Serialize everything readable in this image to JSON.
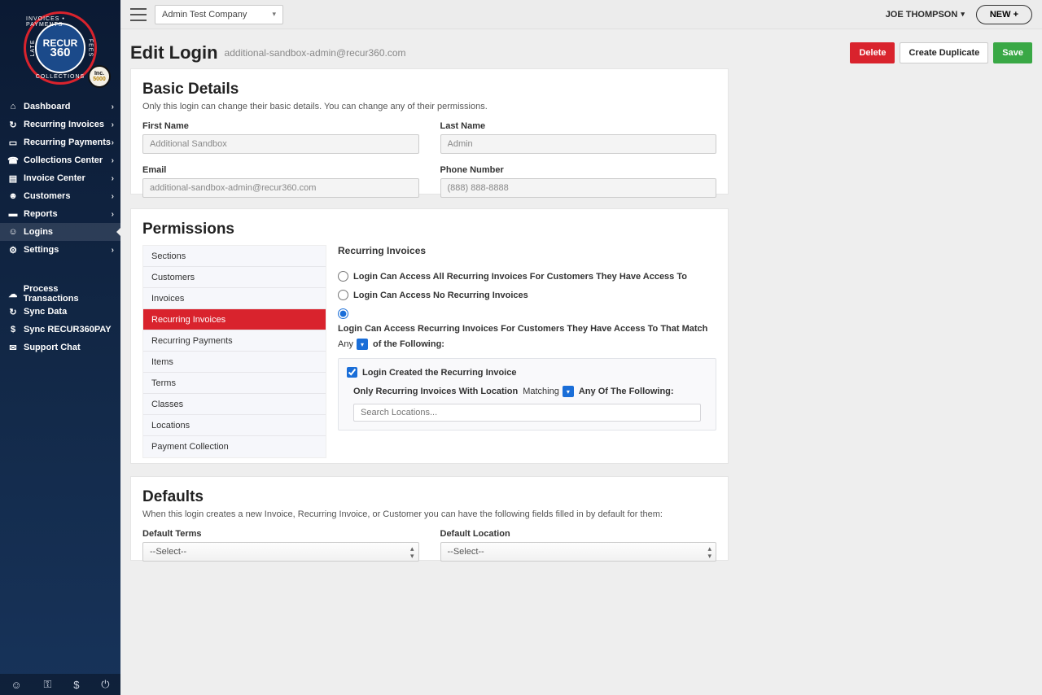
{
  "brand": {
    "name": "RECUR",
    "num": "360",
    "ring_top": "INVOICES • PAYMENTS",
    "ring_bottom": "COLLECTIONS",
    "ring_left": "LATE",
    "ring_right": "FEES",
    "inc1": "Inc.",
    "inc2": "5000"
  },
  "topbar": {
    "company": "Admin Test Company",
    "user": "JOE THOMPSON",
    "new": "NEW +"
  },
  "page": {
    "title": "Edit Login",
    "email": "additional-sandbox-admin@recur360.com",
    "actions": {
      "delete": "Delete",
      "dup": "Create Duplicate",
      "save": "Save"
    }
  },
  "nav": {
    "items": [
      {
        "icon": "⌂",
        "label": "Dashboard",
        "arrow": true
      },
      {
        "icon": "↻",
        "label": "Recurring Invoices",
        "arrow": true
      },
      {
        "icon": "☰",
        "label": "Recurring Payments",
        "arrow": true
      },
      {
        "icon": "☎",
        "label": "Collections Center",
        "arrow": true
      },
      {
        "icon": "▤",
        "label": "Invoice Center",
        "arrow": true
      },
      {
        "icon": "☻",
        "label": "Customers",
        "arrow": true
      },
      {
        "icon": "▬",
        "label": "Reports",
        "arrow": true
      },
      {
        "icon": "☺",
        "label": "Logins",
        "arrow": false,
        "active": true
      },
      {
        "icon": "⚙",
        "label": "Settings",
        "arrow": true
      }
    ],
    "utility": [
      {
        "icon": "☁",
        "label": "Process Transactions"
      },
      {
        "icon": "↻",
        "label": "Sync Data"
      },
      {
        "icon": "$",
        "label": "Sync RECUR360PAY"
      },
      {
        "icon": "✉",
        "label": "Support Chat"
      }
    ]
  },
  "basic": {
    "heading": "Basic Details",
    "desc": "Only this login can change their basic details. You can change any of their permissions.",
    "first_label": "First Name",
    "first_val": "Additional Sandbox",
    "last_label": "Last Name",
    "last_val": "Admin",
    "email_label": "Email",
    "email_val": "additional-sandbox-admin@recur360.com",
    "phone_label": "Phone Number",
    "phone_val": "(888) 888-8888"
  },
  "perm": {
    "heading": "Permissions",
    "tabs": [
      "Sections",
      "Customers",
      "Invoices",
      "Recurring Invoices",
      "Recurring Payments",
      "Items",
      "Terms",
      "Classes",
      "Locations",
      "Payment Collection"
    ],
    "active_tab": 3,
    "content_title": "Recurring Invoices",
    "r1": "Login Can Access All Recurring Invoices For Customers They Have Access To",
    "r2": "Login Can Access No Recurring Invoices",
    "r3_a": "Login Can Access Recurring Invoices For Customers They Have Access To That Match",
    "r3_sel": "Any",
    "r3_b": "of the Following:",
    "c1": "Login Created the Recurring Invoice",
    "loc_a": "Only Recurring Invoices With Location",
    "loc_sel": "Matching",
    "loc_b": "Any Of The Following:",
    "loc_placeholder": "Search Locations..."
  },
  "defaults": {
    "heading": "Defaults",
    "desc": "When this login creates a new Invoice, Recurring Invoice, or Customer you can have the following fields filled in by default for them:",
    "terms_label": "Default Terms",
    "terms_val": "--Select--",
    "loc_label": "Default Location",
    "loc_val": "--Select--"
  },
  "footer_icons": [
    "user",
    "key",
    "dollar",
    "power"
  ]
}
